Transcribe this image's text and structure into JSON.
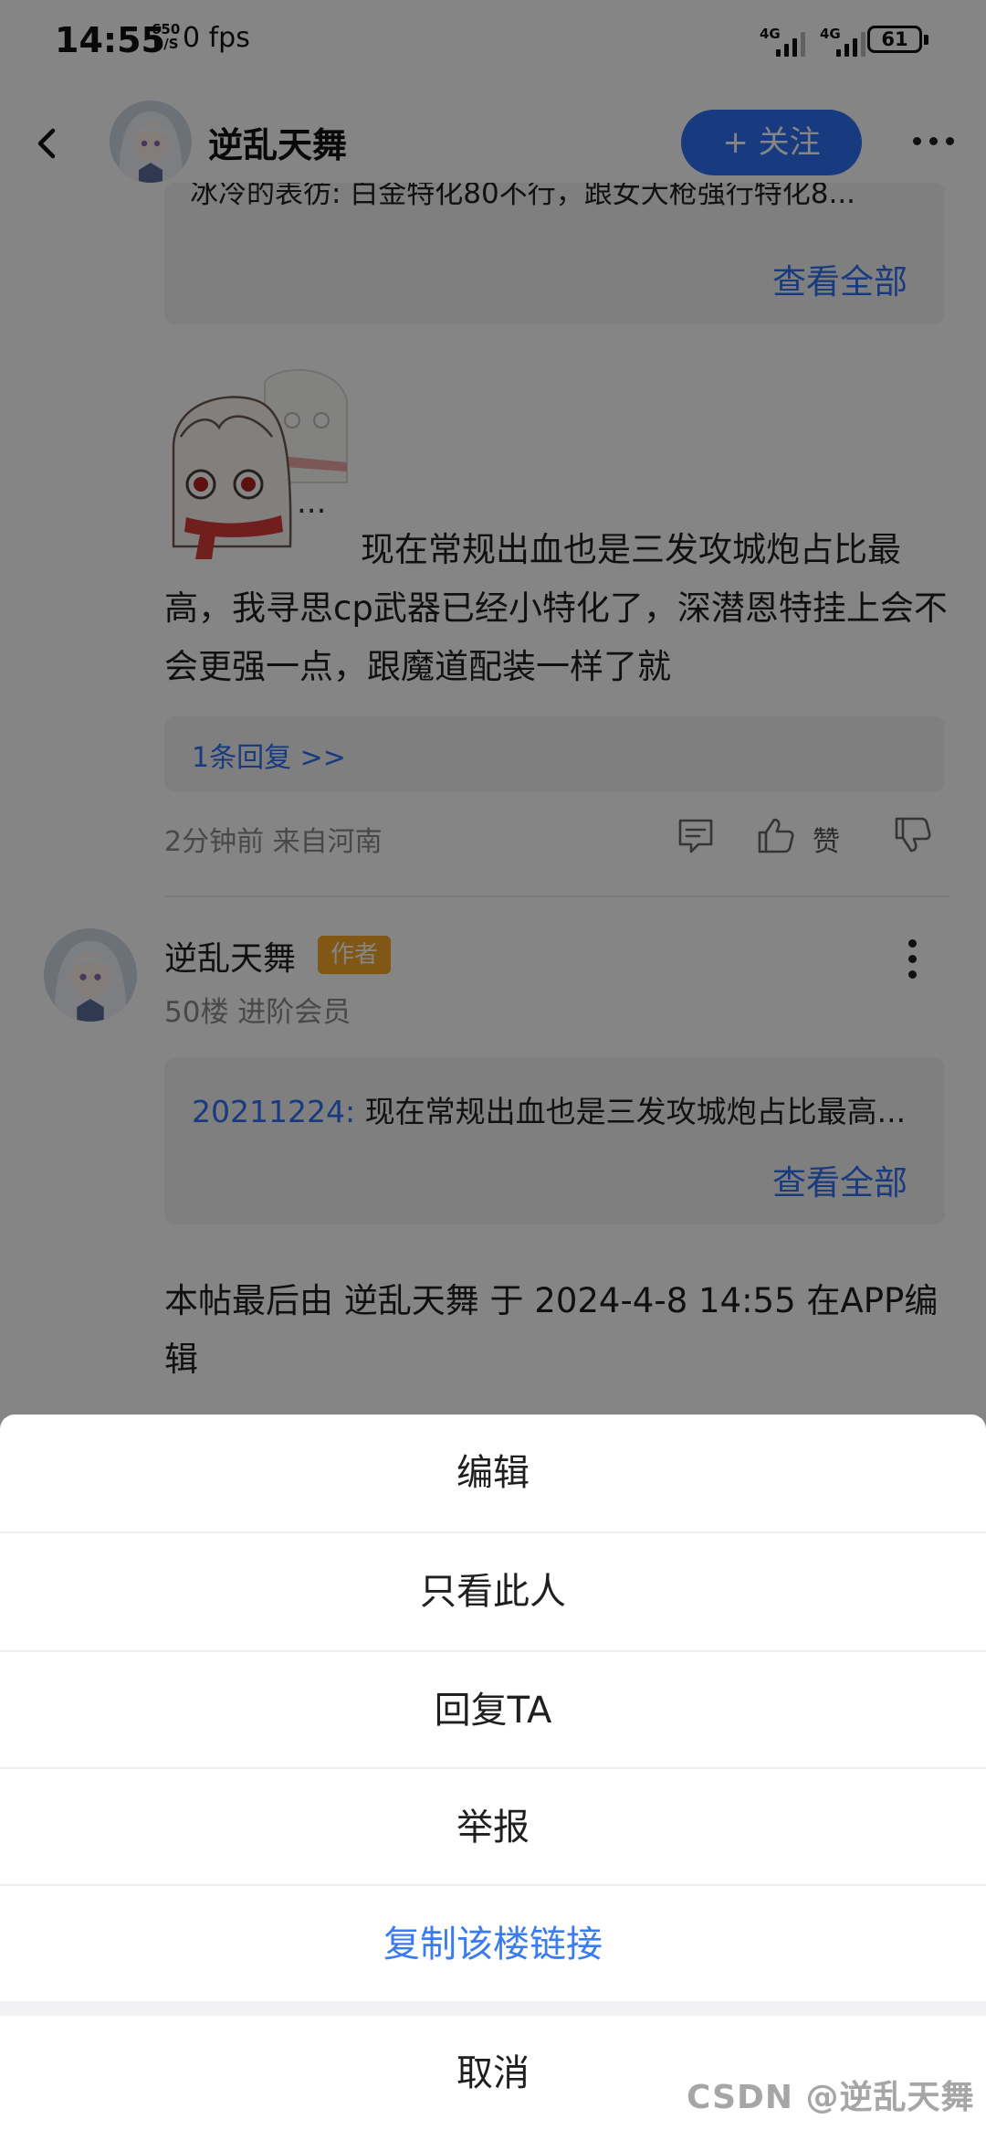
{
  "status_bar": {
    "time": "14:55",
    "net_speed_value": "650",
    "net_speed_unit": "B/S",
    "fps_text": "0 fps",
    "sim1_label": "4G",
    "sim2_label": "4G",
    "battery": "61"
  },
  "header": {
    "title": "逆乱天舞",
    "follow_label": "+ 关注"
  },
  "prev_post": {
    "quote_text": "冰冷的表彷: 白金特化80不行，跟女大枪强行特化8...",
    "view_all": "查看全部",
    "body_text": "现在常规出血也是三发攻城炮占比最高，我寻思cp武器已经小特化了，深潜恩特挂上会不会更强一点，跟魔道配装一样了就",
    "sticker_ellipsis": "...",
    "replies_link": "1条回复 >>",
    "meta": "2分钟前 来自河南",
    "like_label": "赞"
  },
  "post": {
    "author": "逆乱天舞",
    "badge": "作者",
    "floor_info": "50楼 进阶会员",
    "quote_author": "20211224:",
    "quote_text": " 现在常规出血也是三发攻城炮占比最高...",
    "view_all": "查看全部",
    "edit_note": "本帖最后由 逆乱天舞 于 2024-4-8 14:55 在APP编辑"
  },
  "action_sheet": {
    "items": [
      "编辑",
      "只看此人",
      "回复TA",
      "举报",
      "复制该楼链接"
    ],
    "cancel": "取消"
  },
  "watermark": "CSDN @逆乱天舞",
  "colors": {
    "accent": "#2f6ff2",
    "badge": "#f7a829",
    "overlay": "rgba(0,0,0,0.48)"
  }
}
